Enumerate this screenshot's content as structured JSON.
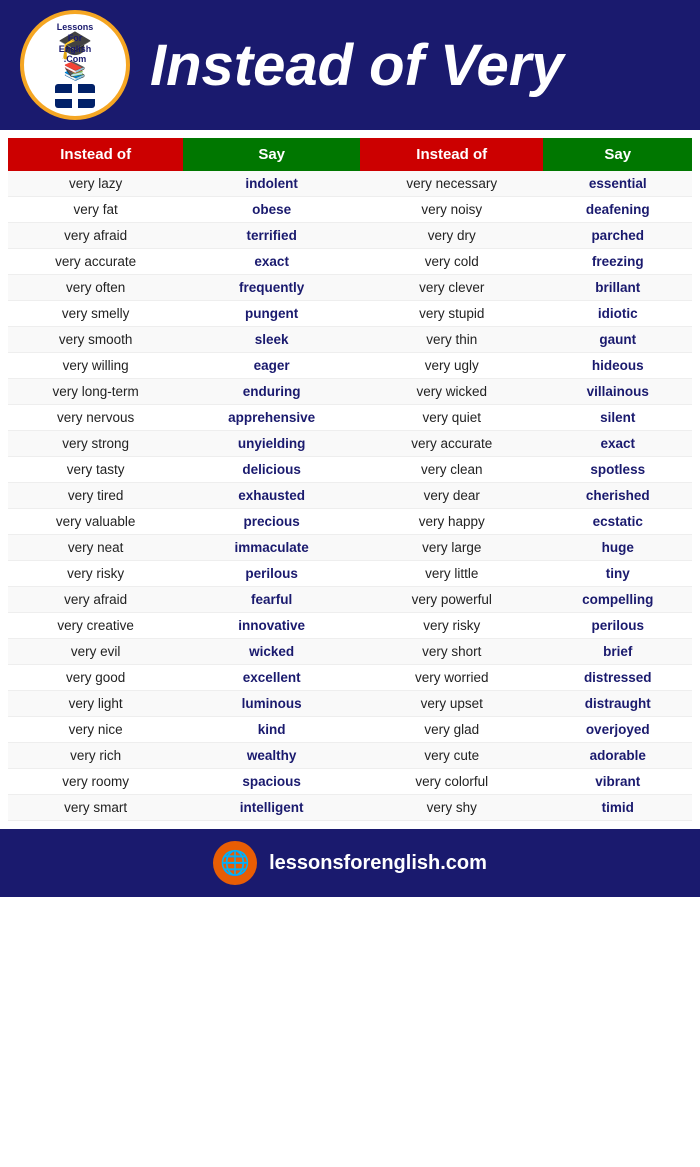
{
  "header": {
    "title": "Instead of Very",
    "logo_top_text": "LessonsForEnglish.Com"
  },
  "table": {
    "col1_header": "Instead of",
    "col2_header": "Say",
    "col3_header": "Instead of",
    "col4_header": "Say",
    "rows": [
      [
        "very lazy",
        "indolent",
        "very necessary",
        "essential"
      ],
      [
        "very fat",
        "obese",
        "very noisy",
        "deafening"
      ],
      [
        "very afraid",
        "terrified",
        "very dry",
        "parched"
      ],
      [
        "very accurate",
        "exact",
        "very cold",
        "freezing"
      ],
      [
        "very often",
        "frequently",
        "very clever",
        "brillant"
      ],
      [
        "very smelly",
        "pungent",
        "very stupid",
        "idiotic"
      ],
      [
        "very smooth",
        "sleek",
        "very thin",
        "gaunt"
      ],
      [
        "very willing",
        "eager",
        "very ugly",
        "hideous"
      ],
      [
        "very long-term",
        "enduring",
        "very wicked",
        "villainous"
      ],
      [
        "very nervous",
        "apprehensive",
        "very quiet",
        "silent"
      ],
      [
        "very strong",
        "unyielding",
        "very accurate",
        "exact"
      ],
      [
        "very tasty",
        "delicious",
        "very clean",
        "spotless"
      ],
      [
        "very tired",
        "exhausted",
        "very dear",
        "cherished"
      ],
      [
        "very valuable",
        "precious",
        "very happy",
        "ecstatic"
      ],
      [
        "very neat",
        "immaculate",
        "very large",
        "huge"
      ],
      [
        "very risky",
        "perilous",
        "very little",
        "tiny"
      ],
      [
        "very afraid",
        "fearful",
        "very powerful",
        "compelling"
      ],
      [
        "very creative",
        "innovative",
        "very risky",
        "perilous"
      ],
      [
        "very evil",
        "wicked",
        "very short",
        "brief"
      ],
      [
        "very good",
        "excellent",
        "very worried",
        "distressed"
      ],
      [
        "very light",
        "luminous",
        "very upset",
        "distraught"
      ],
      [
        "very nice",
        "kind",
        "very glad",
        "overjoyed"
      ],
      [
        "very rich",
        "wealthy",
        "very cute",
        "adorable"
      ],
      [
        "very roomy",
        "spacious",
        "very colorful",
        "vibrant"
      ],
      [
        "very smart",
        "intelligent",
        "very shy",
        "timid"
      ]
    ]
  },
  "footer": {
    "website": "lessonsforenglish.com"
  }
}
